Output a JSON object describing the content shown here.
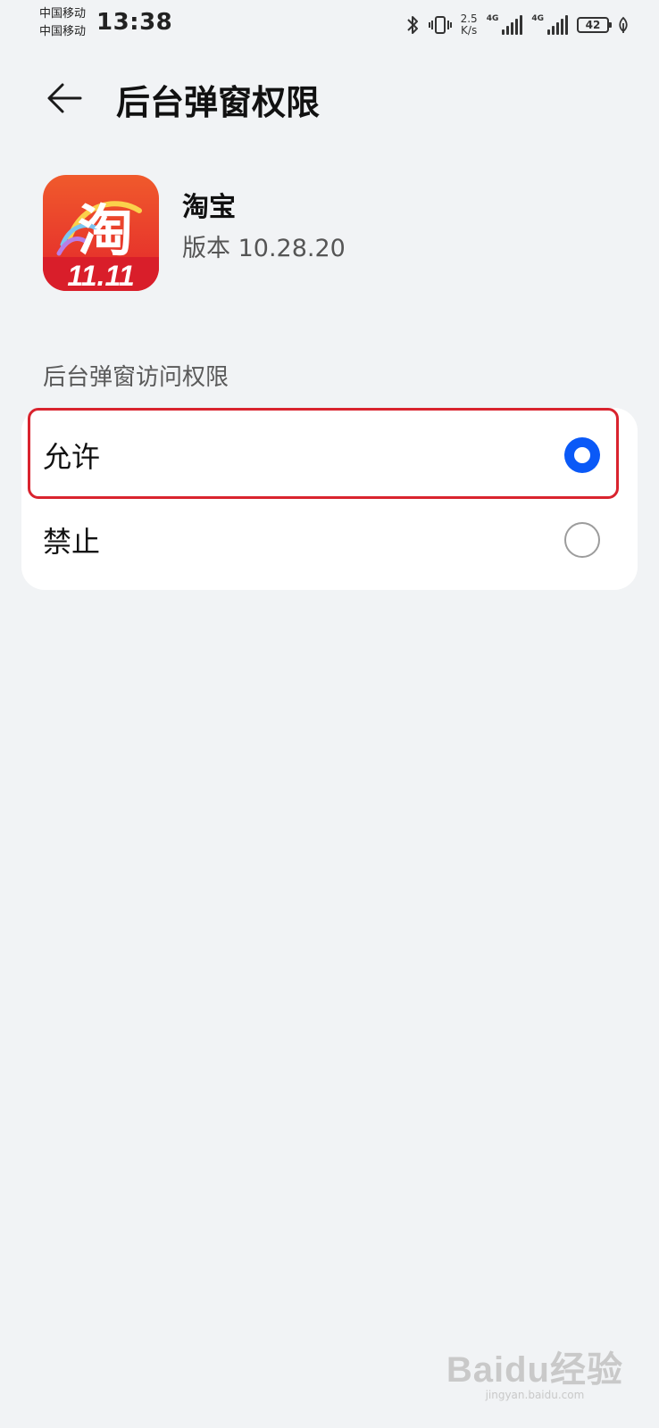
{
  "status_bar": {
    "carrier_1": "中国移动",
    "carrier_2": "中国移动",
    "time": "13:38",
    "net_speed_value": "2.5",
    "net_speed_unit": "K/s",
    "sim1_tag": "4G",
    "sim2_tag": "4G",
    "battery": "42"
  },
  "header": {
    "title": "后台弹窗权限"
  },
  "app": {
    "name": "淘宝",
    "version": "版本 10.28.20",
    "icon_text": "11.11"
  },
  "section": {
    "title": "后台弹窗访问权限"
  },
  "options": [
    {
      "label": "允许",
      "selected": true
    },
    {
      "label": "禁止",
      "selected": false
    }
  ],
  "colors": {
    "accent": "#0a59f7",
    "highlight": "#d9232e",
    "background": "#f1f3f5",
    "app_icon": "#e8322b"
  },
  "watermark": {
    "main": "Baidu经验",
    "sub": "jingyan.baidu.com"
  }
}
